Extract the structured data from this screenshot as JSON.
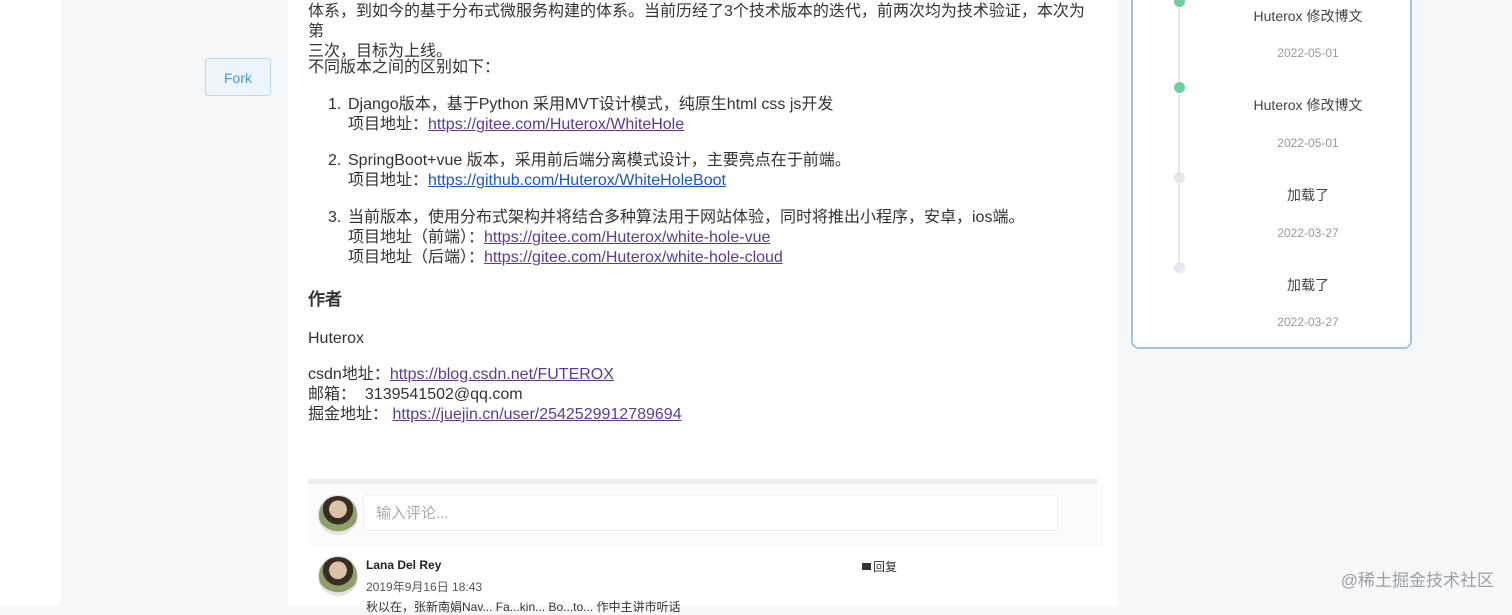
{
  "fork_label": "Fork",
  "article": {
    "intro_line1": "体系，到如今的基于分布式微服务构建的体系。当前历经了3个技术版本的迭代，前两次均为技术验证，本次为第",
    "intro_line2": "三次，目标为上线。",
    "diff_heading": "不同版本之间的区别如下：",
    "items": [
      {
        "num": "1.",
        "desc": "Django版本，基于Python 采用MVT设计模式，纯原生html css js开发",
        "addr_label": "项目地址：",
        "addr_url": "https://gitee.com/Huterox/WhiteHole"
      },
      {
        "num": "2.",
        "desc": "SpringBoot+vue 版本，采用前后端分离模式设计，主要亮点在于前端。",
        "addr_label": "项目地址：",
        "addr_url": "https://github.com/Huterox/WhiteHoleBoot"
      },
      {
        "num": "3.",
        "desc": "当前版本，使用分布式架构并将结合多种算法用于网站体验，同时将推出小程序，安卓，ios端。",
        "front_label": "项目地址（前端）：",
        "front_url": "https://gitee.com/Huterox/white-hole-vue",
        "back_label": "项目地址（后端）：",
        "back_url": "https://gitee.com/Huterox/white-hole-cloud"
      }
    ],
    "author_heading": "作者",
    "author_name": "Huterox",
    "csdn_label": "csdn地址：",
    "csdn_url": "https://blog.csdn.net/FUTEROX",
    "email_label": "邮箱：",
    "email_value": "3139541502@qq.com",
    "juejin_label": "掘金地址：",
    "juejin_url": "https://juejin.cn/user/2542529912789694"
  },
  "comments": {
    "input_placeholder": "输入评论...",
    "entries": [
      {
        "author": "Lana Del Rey",
        "time": "2019年9月16日 18:43",
        "reply_label": "回复",
        "text": "秋以在，张新南娟Nav... Fa...kin... Bo...to... 作中主讲市听话"
      }
    ]
  },
  "timeline": [
    {
      "title": "Huterox 修改博文",
      "date": "2022-05-01",
      "active": true
    },
    {
      "title": "Huterox 修改博文",
      "date": "2022-05-01",
      "active": true
    },
    {
      "title": "加载了",
      "date": "2022-03-27",
      "active": false
    },
    {
      "title": "加载了",
      "date": "2022-03-27",
      "active": false
    }
  ],
  "watermark": "@稀土掘金技术社区"
}
